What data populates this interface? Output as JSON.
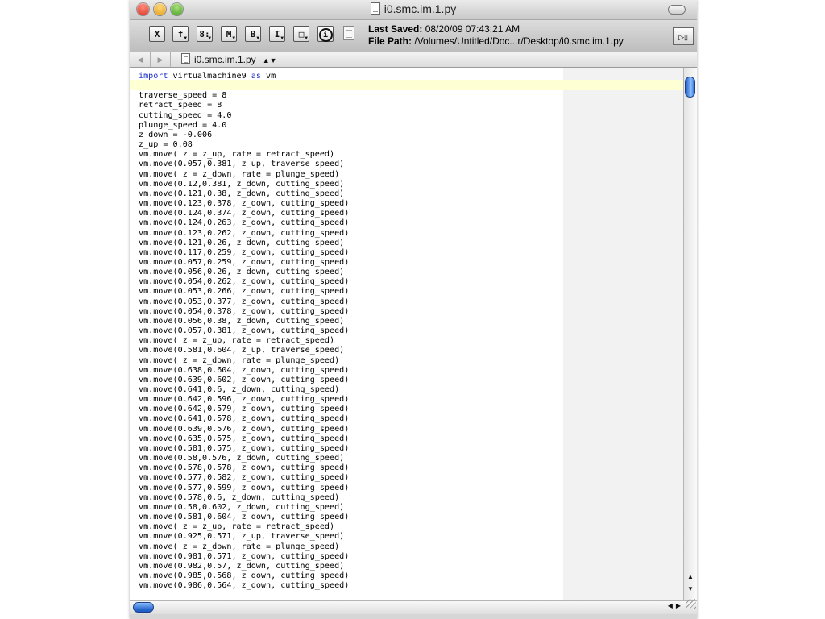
{
  "window": {
    "title": "i0.smc.im.1.py"
  },
  "toolbar": {
    "buttons": [
      {
        "name": "no-symbol-button",
        "glyph": "X"
      },
      {
        "name": "function-menu-button",
        "glyph": "f"
      },
      {
        "name": "marker-menu-button",
        "glyph": "8:"
      },
      {
        "name": "mark-menu-button",
        "glyph": "M"
      },
      {
        "name": "document-menu-button",
        "glyph": "B"
      },
      {
        "name": "text-menu-button",
        "glyph": "I"
      },
      {
        "name": "window-menu-button",
        "glyph": "□"
      },
      {
        "name": "info-button",
        "glyph": "i"
      }
    ],
    "last_saved_label": "Last Saved:",
    "last_saved_value": "08/20/09 07:43:21 AM",
    "file_path_label": "File Path:",
    "file_path_value": "/Volumes/Untitled/Doc...r/Desktop/i0.smc.im.1.py"
  },
  "navbar": {
    "back_arrow": "◀",
    "forward_arrow": "▶",
    "file_name": "i0.smc.im.1.py",
    "updown": "▲▼"
  },
  "editor": {
    "first_line_keyword_import": "import",
    "first_line_module": " virtualmachine9 ",
    "first_line_keyword_as": "as",
    "first_line_alias": " vm",
    "code_lines": [
      "",
      "traverse_speed = 8",
      "retract_speed = 8",
      "cutting_speed = 4.0",
      "plunge_speed = 4.0",
      "z_down = -0.006",
      "z_up = 0.08",
      "vm.move( z = z_up, rate = retract_speed)",
      "vm.move(0.057,0.381, z_up, traverse_speed)",
      "vm.move( z = z_down, rate = plunge_speed)",
      "vm.move(0.12,0.381, z_down, cutting_speed)",
      "vm.move(0.121,0.38, z_down, cutting_speed)",
      "vm.move(0.123,0.378, z_down, cutting_speed)",
      "vm.move(0.124,0.374, z_down, cutting_speed)",
      "vm.move(0.124,0.263, z_down, cutting_speed)",
      "vm.move(0.123,0.262, z_down, cutting_speed)",
      "vm.move(0.121,0.26, z_down, cutting_speed)",
      "vm.move(0.117,0.259, z_down, cutting_speed)",
      "vm.move(0.057,0.259, z_down, cutting_speed)",
      "vm.move(0.056,0.26, z_down, cutting_speed)",
      "vm.move(0.054,0.262, z_down, cutting_speed)",
      "vm.move(0.053,0.266, z_down, cutting_speed)",
      "vm.move(0.053,0.377, z_down, cutting_speed)",
      "vm.move(0.054,0.378, z_down, cutting_speed)",
      "vm.move(0.056,0.38, z_down, cutting_speed)",
      "vm.move(0.057,0.381, z_down, cutting_speed)",
      "vm.move( z = z_up, rate = retract_speed)",
      "vm.move(0.581,0.604, z_up, traverse_speed)",
      "vm.move( z = z_down, rate = plunge_speed)",
      "vm.move(0.638,0.604, z_down, cutting_speed)",
      "vm.move(0.639,0.602, z_down, cutting_speed)",
      "vm.move(0.641,0.6, z_down, cutting_speed)",
      "vm.move(0.642,0.596, z_down, cutting_speed)",
      "vm.move(0.642,0.579, z_down, cutting_speed)",
      "vm.move(0.641,0.578, z_down, cutting_speed)",
      "vm.move(0.639,0.576, z_down, cutting_speed)",
      "vm.move(0.635,0.575, z_down, cutting_speed)",
      "vm.move(0.581,0.575, z_down, cutting_speed)",
      "vm.move(0.58,0.576, z_down, cutting_speed)",
      "vm.move(0.578,0.578, z_down, cutting_speed)",
      "vm.move(0.577,0.582, z_down, cutting_speed)",
      "vm.move(0.577,0.599, z_down, cutting_speed)",
      "vm.move(0.578,0.6, z_down, cutting_speed)",
      "vm.move(0.58,0.602, z_down, cutting_speed)",
      "vm.move(0.581,0.604, z_down, cutting_speed)",
      "vm.move( z = z_up, rate = retract_speed)",
      "vm.move(0.925,0.571, z_up, traverse_speed)",
      "vm.move( z = z_down, rate = plunge_speed)",
      "vm.move(0.981,0.571, z_down, cutting_speed)",
      "vm.move(0.982,0.57, z_down, cutting_speed)",
      "vm.move(0.985,0.568, z_down, cutting_speed)",
      "vm.move(0.986,0.564, z_down, cutting_speed)"
    ]
  },
  "scrollbar": {
    "up_arrow": "▲",
    "down_arrow": "▼",
    "left_arrow": "◀",
    "right_arrow": "▶"
  },
  "colors": {
    "keyword": "#1d30c8",
    "current_line": "#ffffd4",
    "scroll_thumb": "#2a68cf"
  }
}
